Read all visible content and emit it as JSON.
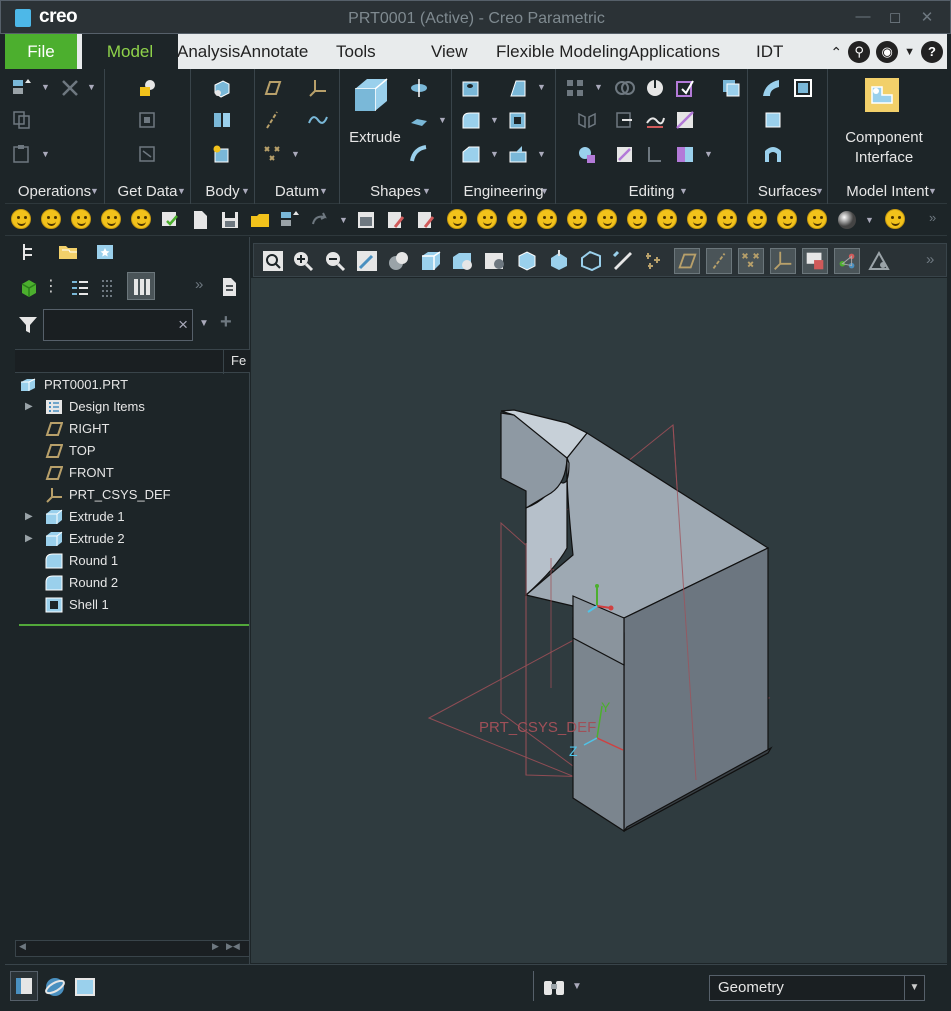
{
  "window": {
    "brand": "creo",
    "title": "PRT0001 (Active) - Creo Parametric",
    "controls": [
      "minimize-icon",
      "maximize-icon",
      "close-icon"
    ]
  },
  "menu": {
    "tabs": [
      "File",
      "Model",
      "AnalysisAnnotate",
      "Tools",
      "View",
      "Flexible ModelingApplications",
      "IDT"
    ],
    "active_tab": "Model"
  },
  "ribbon": {
    "groups": [
      {
        "label": "Operations"
      },
      {
        "label": "Get Data"
      },
      {
        "label": "Body"
      },
      {
        "label": "Datum"
      },
      {
        "label": "Shapes",
        "big_button": "Extrude"
      },
      {
        "label": "Engineering"
      },
      {
        "label": "Editing"
      },
      {
        "label": "Surfaces"
      },
      {
        "label": "Model Intent",
        "big_button_line1": "Component",
        "big_button_line2": "Interface"
      }
    ]
  },
  "model_tree": {
    "column_header": "Fe",
    "items": [
      {
        "label": "PRT0001.PRT",
        "icon": "part-icon",
        "expandable": false,
        "indent": 0
      },
      {
        "label": "Design Items",
        "icon": "design-items-icon",
        "expandable": true,
        "indent": 1
      },
      {
        "label": "RIGHT",
        "icon": "datum-plane-icon",
        "expandable": false,
        "indent": 1
      },
      {
        "label": "TOP",
        "icon": "datum-plane-icon",
        "expandable": false,
        "indent": 1
      },
      {
        "label": "FRONT",
        "icon": "datum-plane-icon",
        "expandable": false,
        "indent": 1
      },
      {
        "label": "PRT_CSYS_DEF",
        "icon": "csys-icon",
        "expandable": false,
        "indent": 1
      },
      {
        "label": "Extrude 1",
        "icon": "extrude-icon",
        "expandable": true,
        "indent": 1
      },
      {
        "label": "Extrude 2",
        "icon": "extrude-icon",
        "expandable": true,
        "indent": 1
      },
      {
        "label": "Round 1",
        "icon": "round-icon",
        "expandable": false,
        "indent": 1
      },
      {
        "label": "Round 2",
        "icon": "round-icon",
        "expandable": false,
        "indent": 1
      },
      {
        "label": "Shell 1",
        "icon": "shell-icon",
        "expandable": false,
        "indent": 1
      }
    ]
  },
  "graphics": {
    "csys_label": "PRT_CSYS_DEF",
    "axis_x": "X",
    "axis_y": "Y",
    "axis_z": "Z"
  },
  "status": {
    "selection_filter": "Geometry"
  },
  "colors": {
    "accent_green": "#4caf2e",
    "model_tab_text": "#8fd34a",
    "background": "#1d2528",
    "graphics_bg": "#2f3b3f"
  }
}
